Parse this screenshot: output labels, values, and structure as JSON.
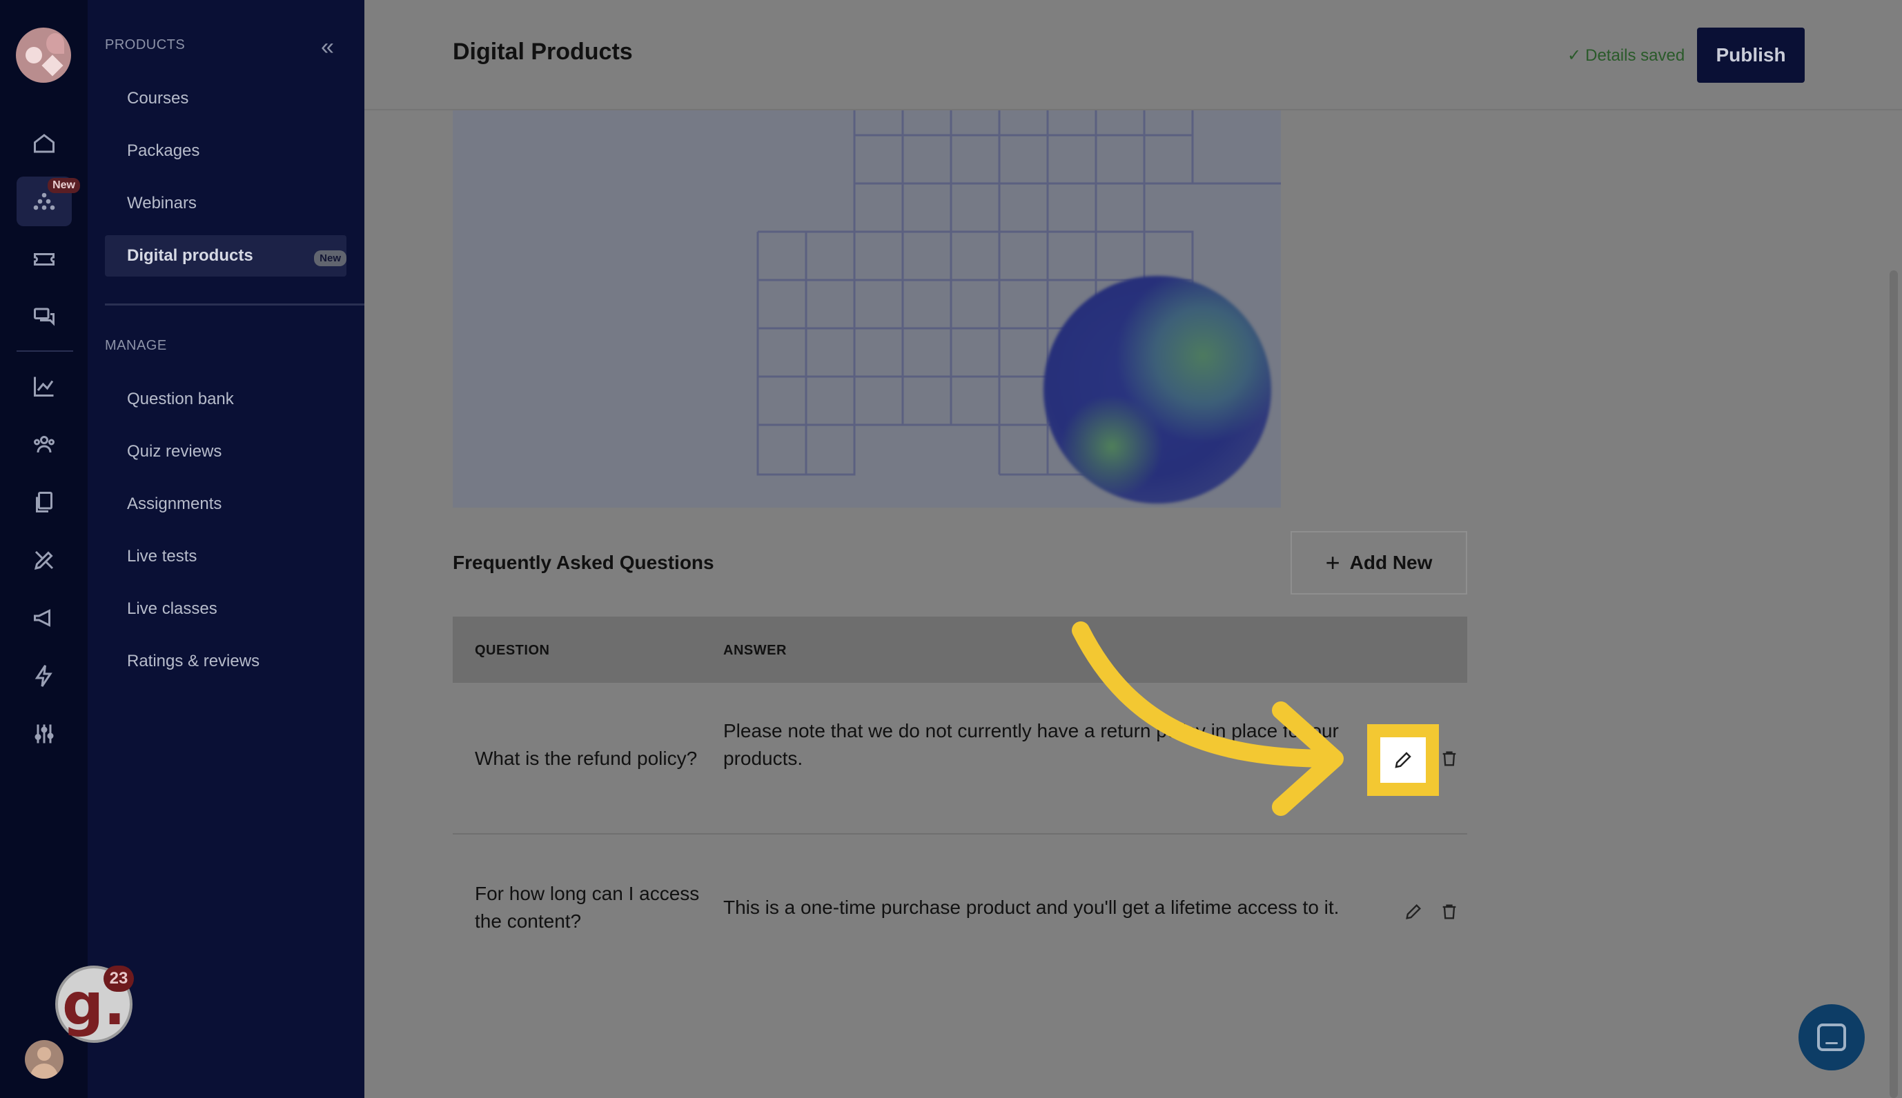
{
  "sidebar": {
    "products_section": "PRODUCTS",
    "manage_section": "MANAGE",
    "rail_new_badge": "New",
    "items_products": [
      {
        "label": "Courses"
      },
      {
        "label": "Packages"
      },
      {
        "label": "Webinars"
      },
      {
        "label": "Digital products",
        "badge": "New",
        "active": true
      }
    ],
    "items_manage": [
      {
        "label": "Question bank"
      },
      {
        "label": "Quiz reviews"
      },
      {
        "label": "Assignments"
      },
      {
        "label": "Live tests"
      },
      {
        "label": "Live classes"
      },
      {
        "label": "Ratings & reviews"
      }
    ],
    "notification_count": "23",
    "brand_letter": "g."
  },
  "header": {
    "title": "Digital Products",
    "status": "Details saved",
    "publish_label": "Publish"
  },
  "faq": {
    "title": "Frequently Asked Questions",
    "add_new_label": "Add New",
    "columns": [
      "QUESTION",
      "ANSWER"
    ],
    "rows": [
      {
        "question": "What is the refund policy?",
        "answer": "Please note that we do not currently have a return policy in place for our products."
      },
      {
        "question": "For how long can I access the content?",
        "answer": "This is a one-time purchase product and you'll get a lifetime access to it."
      }
    ]
  },
  "colors": {
    "sidebar_bg": "#0a1035",
    "rail_bg": "#050a24",
    "highlight": "#f3c832",
    "publish_bg": "#0a1035"
  }
}
